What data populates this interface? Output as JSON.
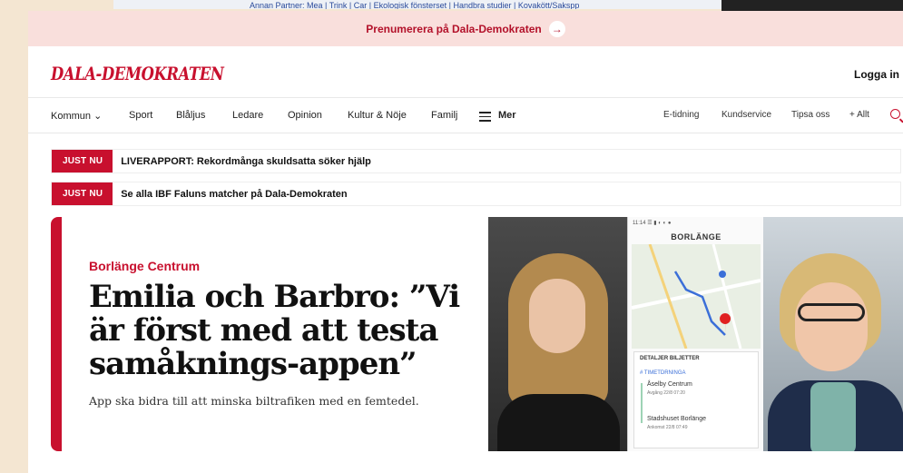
{
  "top_nav_fragment": "Annan Partner: Mea | Trink | Car | Ekologisk fönsterset | Handbra studier | Kovakött/Sakspp",
  "subscribe_banner": {
    "label": "Prenumerera på Dala-Demokraten",
    "arrow_icon": "arrow-right-icon"
  },
  "masthead": {
    "logo": "DALA-DEMOKRATEN",
    "login": "Logga in"
  },
  "nav": {
    "left": [
      "Kommun ⌄",
      "Sport",
      "Blåljus",
      "Ledare",
      "Opinion",
      "Kultur & Nöje",
      "Familj"
    ],
    "menu_label": "Mer",
    "right": [
      "E-tidning",
      "Kundservice",
      "Tipsa oss",
      "+ Allt"
    ],
    "search_icon": "search-icon"
  },
  "breaking": [
    {
      "tag": "JUST NU",
      "text": "LIVERAPPORT: Rekordmånga skuldsatta söker hjälp"
    },
    {
      "tag": "JUST NU",
      "text": "Se alla IBF Faluns matcher på Dala-Demokraten"
    }
  ],
  "lead_story": {
    "kicker": "Borlänge Centrum",
    "headline": "Emilia och Barbro: ”Vi är först med att testa samåknings-appen”",
    "lede": "App ska bidra till att minska biltrafiken med en femtedel.",
    "phone": {
      "status": "11:14 ☰ ▮ ◐ ◐ ●",
      "title": "BORLÄNGE",
      "tabs": "DETALJER   BILJETTER",
      "section": "# TIMETDRNINGA",
      "stop1": "Åselby Centrum",
      "stop1_time": "Avgång 22/8 07:20",
      "stop2": "Stadshuset Borlänge",
      "stop2_time": "Ankomst 22/8 07:49"
    }
  },
  "colors": {
    "brand": "#c8102e",
    "banner_bg": "#f9dfdc"
  }
}
